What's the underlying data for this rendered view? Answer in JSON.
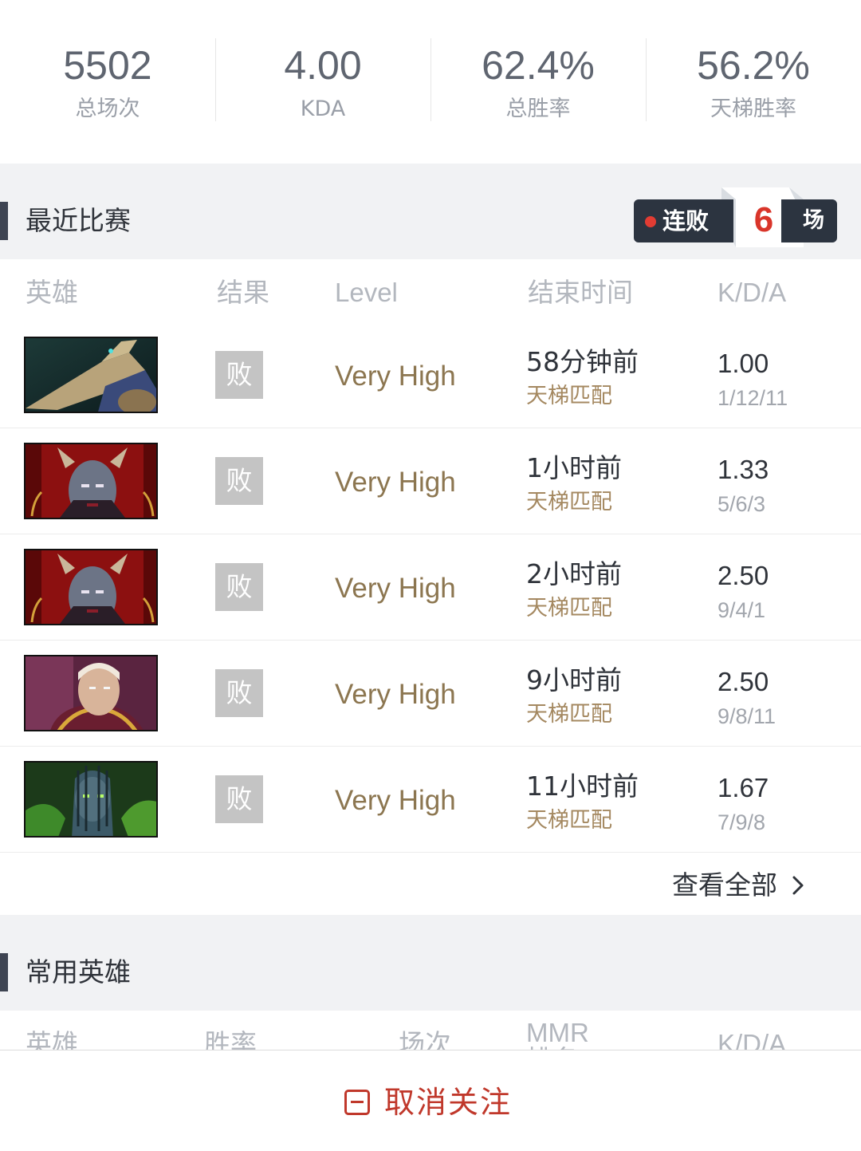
{
  "stats": [
    {
      "value": "5502",
      "label": "总场次"
    },
    {
      "value": "4.00",
      "label": "KDA"
    },
    {
      "value": "62.4%",
      "label": "总胜率"
    },
    {
      "value": "56.2%",
      "label": "天梯胜率"
    }
  ],
  "recent": {
    "title": "最近比赛",
    "streak": {
      "label": "连败",
      "count": "6",
      "unit": "场"
    },
    "headers": {
      "hero": "英雄",
      "result": "结果",
      "level": "Level",
      "end_time": "结束时间",
      "kda": "K/D/A"
    },
    "matches": [
      {
        "hero_icon": "hero-sand-armored-portrait",
        "result": "败",
        "level": "Very High",
        "time": "58分钟前",
        "mode": "天梯匹配",
        "kda": "1.00",
        "kda_detail": "1/12/11"
      },
      {
        "hero_icon": "hero-horned-queen-portrait",
        "result": "败",
        "level": "Very High",
        "time": "1小时前",
        "mode": "天梯匹配",
        "kda": "1.33",
        "kda_detail": "5/6/3"
      },
      {
        "hero_icon": "hero-horned-queen-portrait",
        "result": "败",
        "level": "Very High",
        "time": "2小时前",
        "mode": "天梯匹配",
        "kda": "2.50",
        "kda_detail": "9/4/1"
      },
      {
        "hero_icon": "hero-pale-sorcerer-portrait",
        "result": "败",
        "level": "Very High",
        "time": "9小时前",
        "mode": "天梯匹配",
        "kda": "2.50",
        "kda_detail": "9/8/11"
      },
      {
        "hero_icon": "hero-green-specter-portrait",
        "result": "败",
        "level": "Very High",
        "time": "11小时前",
        "mode": "天梯匹配",
        "kda": "1.67",
        "kda_detail": "7/9/8"
      }
    ],
    "view_all": "查看全部"
  },
  "favorite": {
    "title": "常用英雄",
    "headers": {
      "hero": "英雄",
      "win_rate": "胜率",
      "matches": "场次",
      "mmr": "MMR",
      "mmr_sub": "排名",
      "kda": "K/D/A"
    }
  },
  "bottom": {
    "unfollow_label": "取消关注",
    "unfollow_icon": "minus-square-icon"
  },
  "colors": {
    "accent_red": "#c0382b",
    "level_gold": "#8c7650",
    "loss_badge": "#c4c4c4",
    "streak_dark": "#2c3440"
  }
}
